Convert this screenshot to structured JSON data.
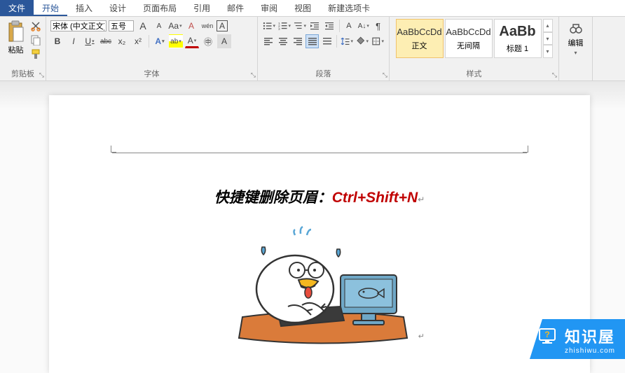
{
  "tabs": {
    "file": "文件",
    "home": "开始",
    "insert": "插入",
    "design": "设计",
    "layout": "页面布局",
    "references": "引用",
    "mailings": "邮件",
    "review": "审阅",
    "view": "视图",
    "newtab": "新建选项卡"
  },
  "clipboard": {
    "paste": "粘贴",
    "label": "剪贴板"
  },
  "font": {
    "name": "宋体 (中文正文)",
    "size": "五号",
    "label": "字体",
    "grow": "A",
    "shrink": "A",
    "case": "Aa",
    "clear": "A",
    "phonetic": "wén",
    "charborder": "A",
    "bold": "B",
    "italic": "I",
    "underline": "U",
    "strike": "abc",
    "sub": "x₂",
    "sup": "x²",
    "effects": "A",
    "highlight": "ab",
    "fontcolor": "A",
    "enclose": "㊥",
    "shading": "A"
  },
  "paragraph": {
    "label": "段落"
  },
  "styles": {
    "label": "样式",
    "items": [
      {
        "preview": "AaBbCcDd",
        "name": "正文",
        "selected": true
      },
      {
        "preview": "AaBbCcDd",
        "name": "无间隔",
        "selected": false
      },
      {
        "preview": "AaBb",
        "name": "标题 1",
        "selected": false,
        "big": true
      }
    ]
  },
  "editing": {
    "label": "编辑"
  },
  "document": {
    "text_black": "快捷键删除页眉：",
    "text_red": "Ctrl+Shift+N",
    "para_mark": "↵"
  },
  "watermark": {
    "title": "知识屋",
    "url": "zhishiwu.com"
  }
}
